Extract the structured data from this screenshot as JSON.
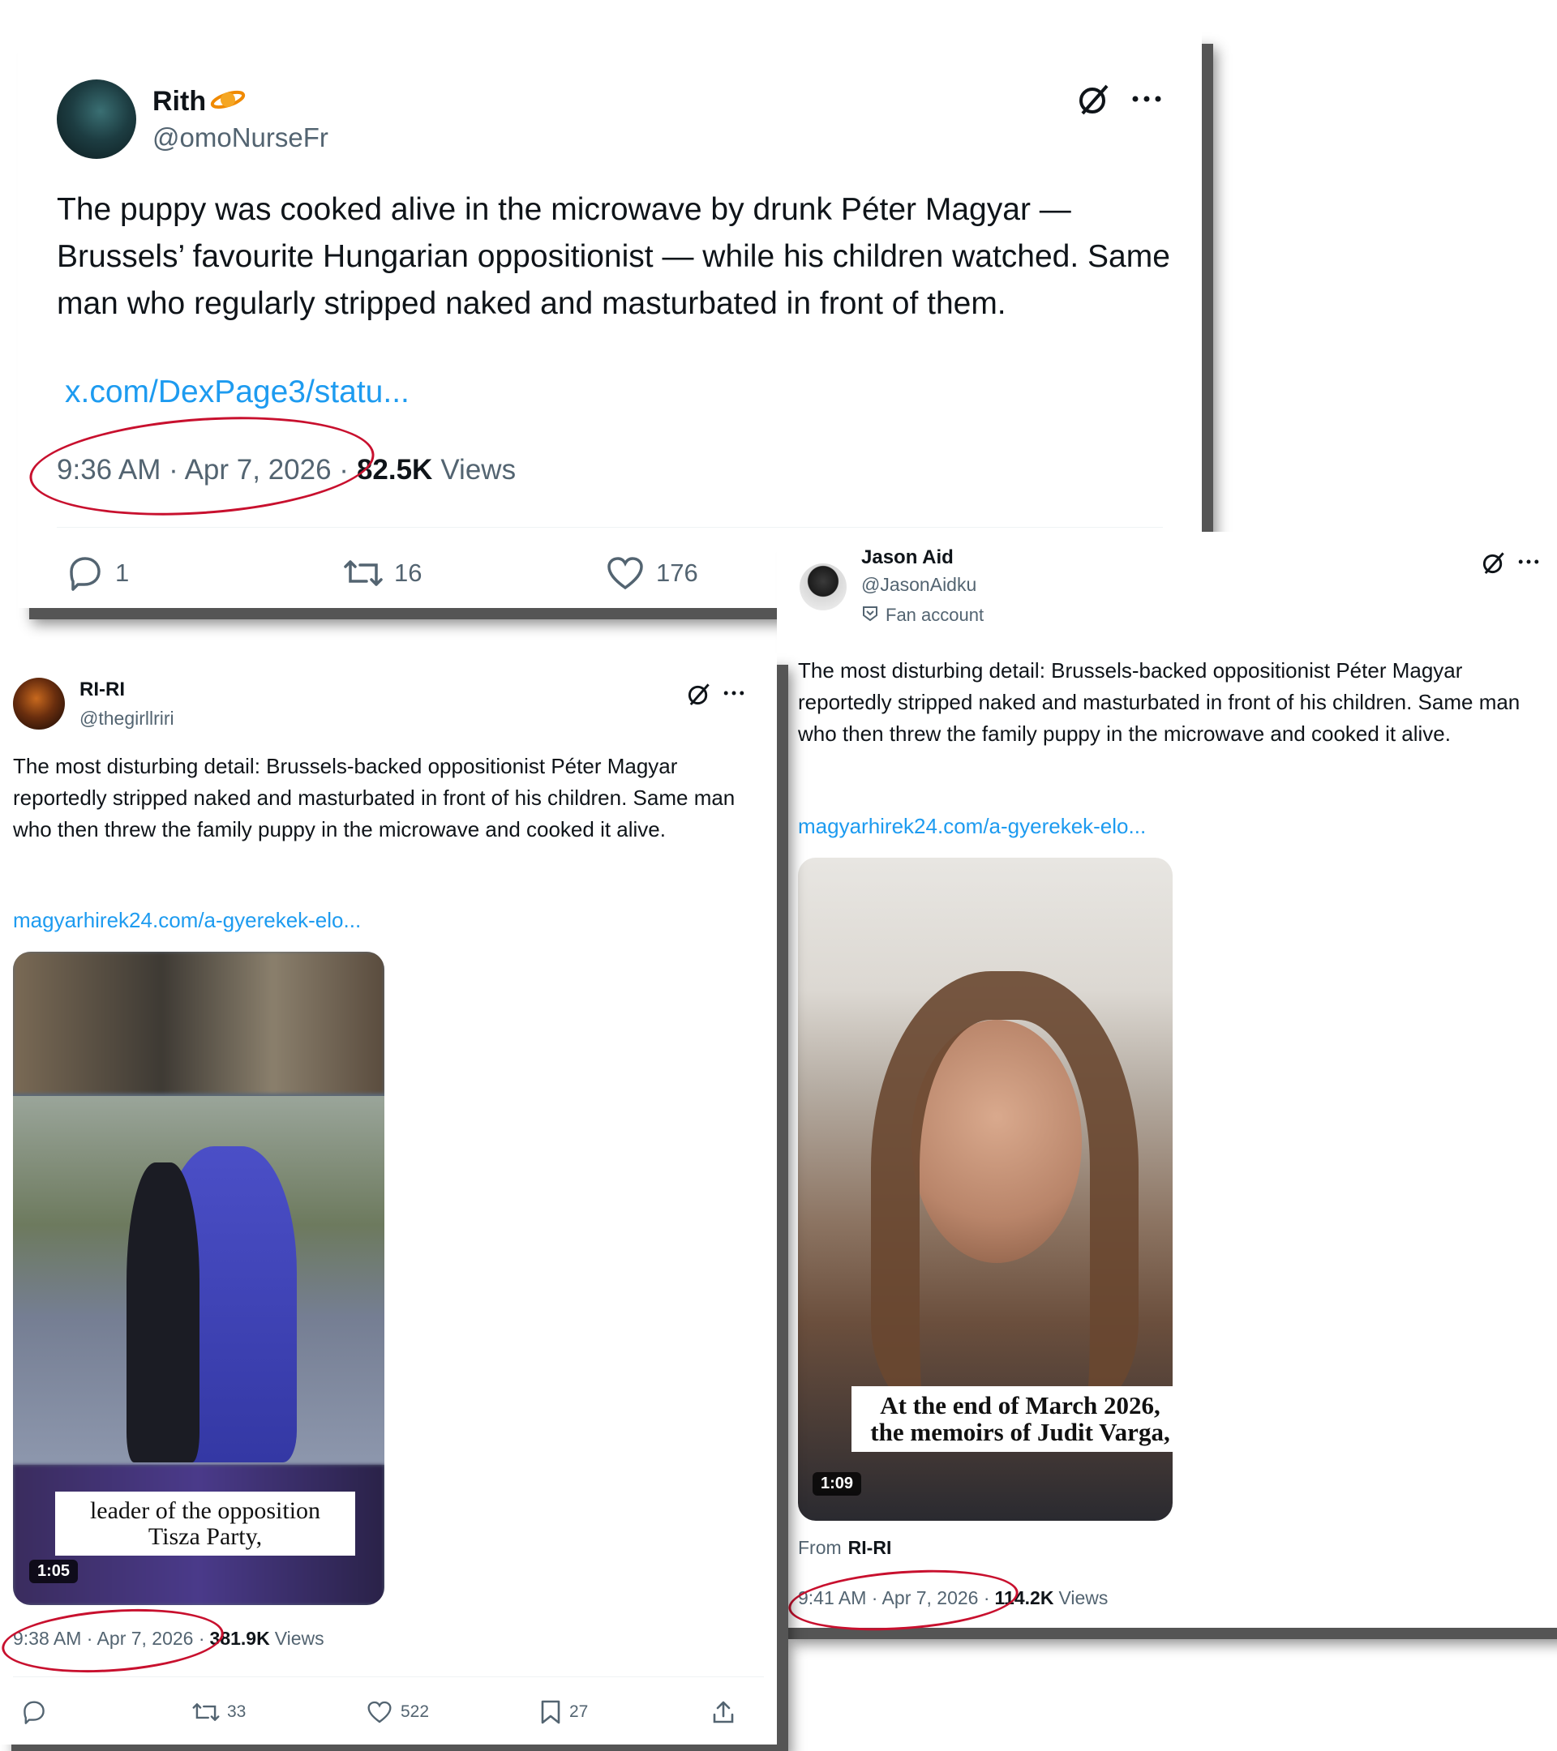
{
  "tweet1": {
    "name": "Rith",
    "handle": "@omoNurseFr",
    "text": "The puppy was cooked alive in the microwave by drunk Péter Magyar — Brussels’ favourite Hungarian oppositionist — while his children watched. Same man who regularly stripped naked and masturbated in front of them.",
    "link": "x.com/DexPage3/statu...",
    "timestamp": "9:36 AM · Apr 7, 2026 ·",
    "views_count": "82.5K",
    "views_label": "Views",
    "replies": "1",
    "reposts": "16",
    "likes": "176"
  },
  "tweet2": {
    "name": "RI-RI",
    "handle": "@thegirllriri",
    "text": "The most disturbing detail: Brussels-backed oppositionist Péter Magyar reportedly stripped naked and masturbated in front of his children. Same man who then threw the family puppy in the microwave and cooked it alive.",
    "link": "magyarhirek24.com/a-gyerekek-elo...",
    "video_caption_1": "leader of the opposition",
    "video_caption_2": "Tisza Party,",
    "video_duration": "1:05",
    "timestamp": "9:38 AM · Apr 7, 2026 ·",
    "views_count": "381.9K",
    "views_label": "Views",
    "reposts": "33",
    "likes": "522",
    "bookmarks": "27"
  },
  "tweet3": {
    "name": "Jason Aid",
    "handle": "@JasonAidku",
    "badge": "Fan account",
    "text": "The most disturbing detail: Brussels-backed oppositionist Péter Magyar reportedly stripped naked and masturbated in front of his children. Same man who then threw the family puppy in the microwave and cooked it alive.",
    "link": "magyarhirek24.com/a-gyerekek-elo...",
    "video_caption_1": "At the end of March 2026,",
    "video_caption_2": "the memoirs of Judit Varga,",
    "video_duration": "1:09",
    "from_label": "From",
    "from_name": "RI-RI",
    "timestamp": "9:41 AM · Apr 7, 2026 ·",
    "views_count": "114.2K",
    "views_label": "Views"
  },
  "colors": {
    "link": "#1d9bf0",
    "annotation_circle": "#c8102e",
    "secondary_text": "#536471"
  },
  "icons": [
    "grok-icon",
    "more-icon",
    "reply-icon",
    "repost-icon",
    "like-icon",
    "bookmark-icon",
    "share-icon",
    "fan-account-icon"
  ]
}
